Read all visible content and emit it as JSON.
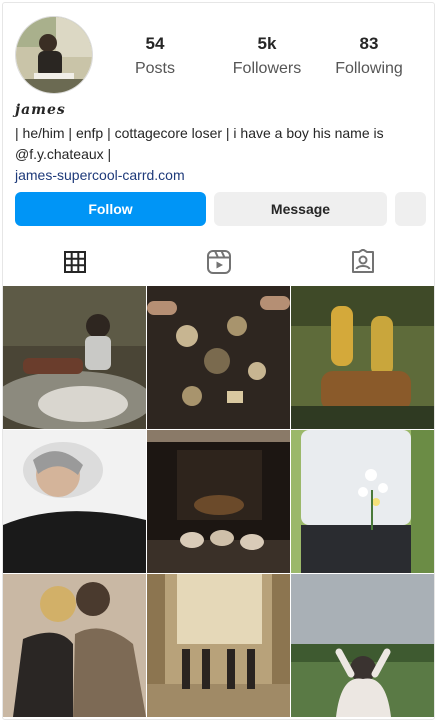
{
  "profile": {
    "username": "james",
    "bio": "| he/him | enfp | cottagecore loser | i have a boy his name is @f.y.chateaux |",
    "link": "james-supercool-carrd.com"
  },
  "stats": [
    {
      "value": "54",
      "label": "Posts"
    },
    {
      "value": "5k",
      "label": "Followers"
    },
    {
      "value": "83",
      "label": "Following"
    }
  ],
  "buttons": {
    "follow": "Follow",
    "message": "Message"
  },
  "tabs": [
    {
      "icon": "grid-icon"
    },
    {
      "icon": "reels-icon"
    },
    {
      "icon": "tagged-icon"
    }
  ],
  "posts": [
    {
      "subject": "two people sitting on a blanket in the woods",
      "palette": [
        "#4a4536",
        "#8c8a7e",
        "#d9d6cf"
      ]
    },
    {
      "subject": "hands around a table with tea and sweets",
      "palette": [
        "#2e2620",
        "#7a6a4e",
        "#c7b591"
      ]
    },
    {
      "subject": "crossed legs with yellow socks in grass",
      "palette": [
        "#5e6b3a",
        "#c9a63c",
        "#2f3a22"
      ]
    },
    {
      "subject": "person lying on a white pillow",
      "palette": [
        "#f2f2f2",
        "#9a9a9a",
        "#1a1a1a"
      ]
    },
    {
      "subject": "socked feet by a fireplace",
      "palette": [
        "#1c1612",
        "#6b4a2a",
        "#d9cbb8"
      ]
    },
    {
      "subject": "flowers in a back pocket",
      "palette": [
        "#e9ecef",
        "#4a7a3a",
        "#2a2c30"
      ]
    },
    {
      "subject": "two people embracing",
      "palette": [
        "#c9b8a4",
        "#3a2f2a",
        "#7d6a55"
      ]
    },
    {
      "subject": "people lying in an ornate hallway",
      "palette": [
        "#b8a27a",
        "#e5d8b8",
        "#2a2420"
      ]
    },
    {
      "subject": "person in a flower field under a grey sky",
      "palette": [
        "#a9b0b6",
        "#5a7a45",
        "#3a3330"
      ]
    }
  ]
}
